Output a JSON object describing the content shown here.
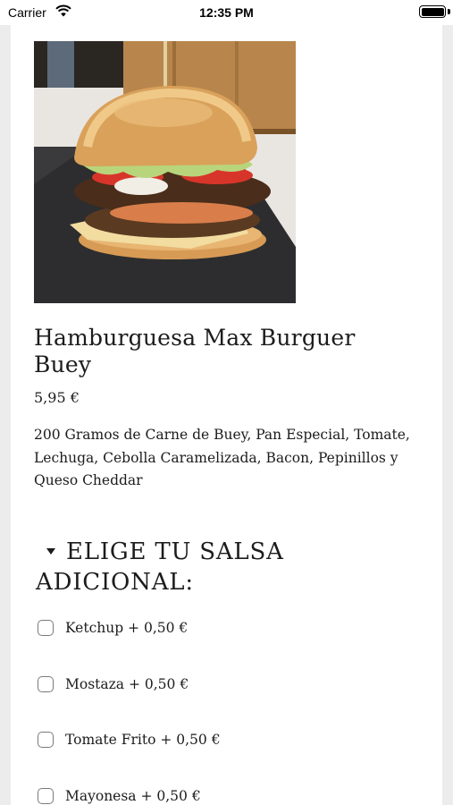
{
  "status_bar": {
    "carrier": "Carrier",
    "time": "12:35 PM"
  },
  "product": {
    "image_alt": "Hamburguesa Max Burguer Buey photo",
    "title": "Hamburguesa Max Burguer Buey",
    "price": "5,95 €",
    "description": "200 Gramos de Carne de Buey, Pan Especial, Tomate, Lechuga, Cebolla Caramelizada, Bacon, Pepinillos y Queso Cheddar"
  },
  "sauce_section": {
    "title": "ELIGE TU SALSA ADICIONAL:",
    "expanded": true,
    "options": [
      {
        "label": "Ketchup + 0,50 €",
        "checked": false
      },
      {
        "label": "Mostaza + 0,50 €",
        "checked": false
      },
      {
        "label": "Tomate Frito + 0,50 €",
        "checked": false
      },
      {
        "label": "Mayonesa + 0,50 €",
        "checked": false
      }
    ]
  }
}
